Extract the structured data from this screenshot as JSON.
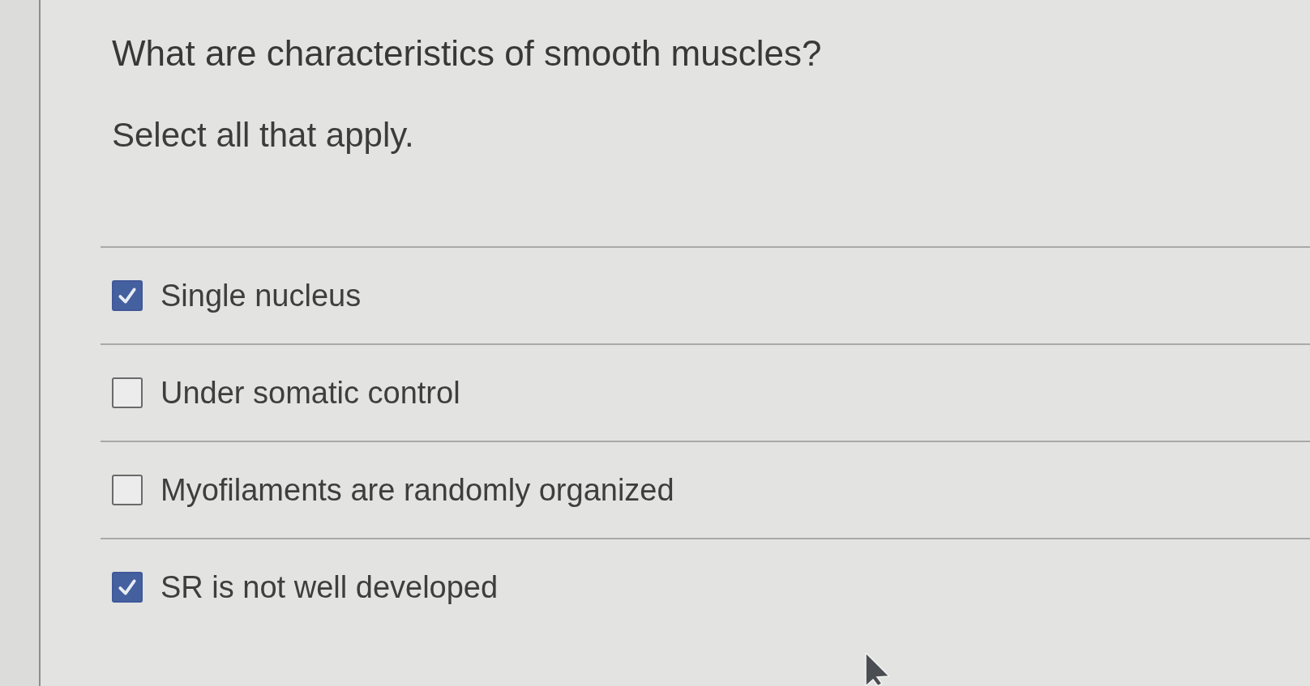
{
  "question": "What are characteristics of smooth muscles?",
  "instruction": "Select all that apply.",
  "options": [
    {
      "label": "Single nucleus",
      "checked": true
    },
    {
      "label": "Under somatic control",
      "checked": false
    },
    {
      "label": "Myofilaments are randomly organized",
      "checked": false
    },
    {
      "label": "SR is not well developed",
      "checked": true
    }
  ]
}
